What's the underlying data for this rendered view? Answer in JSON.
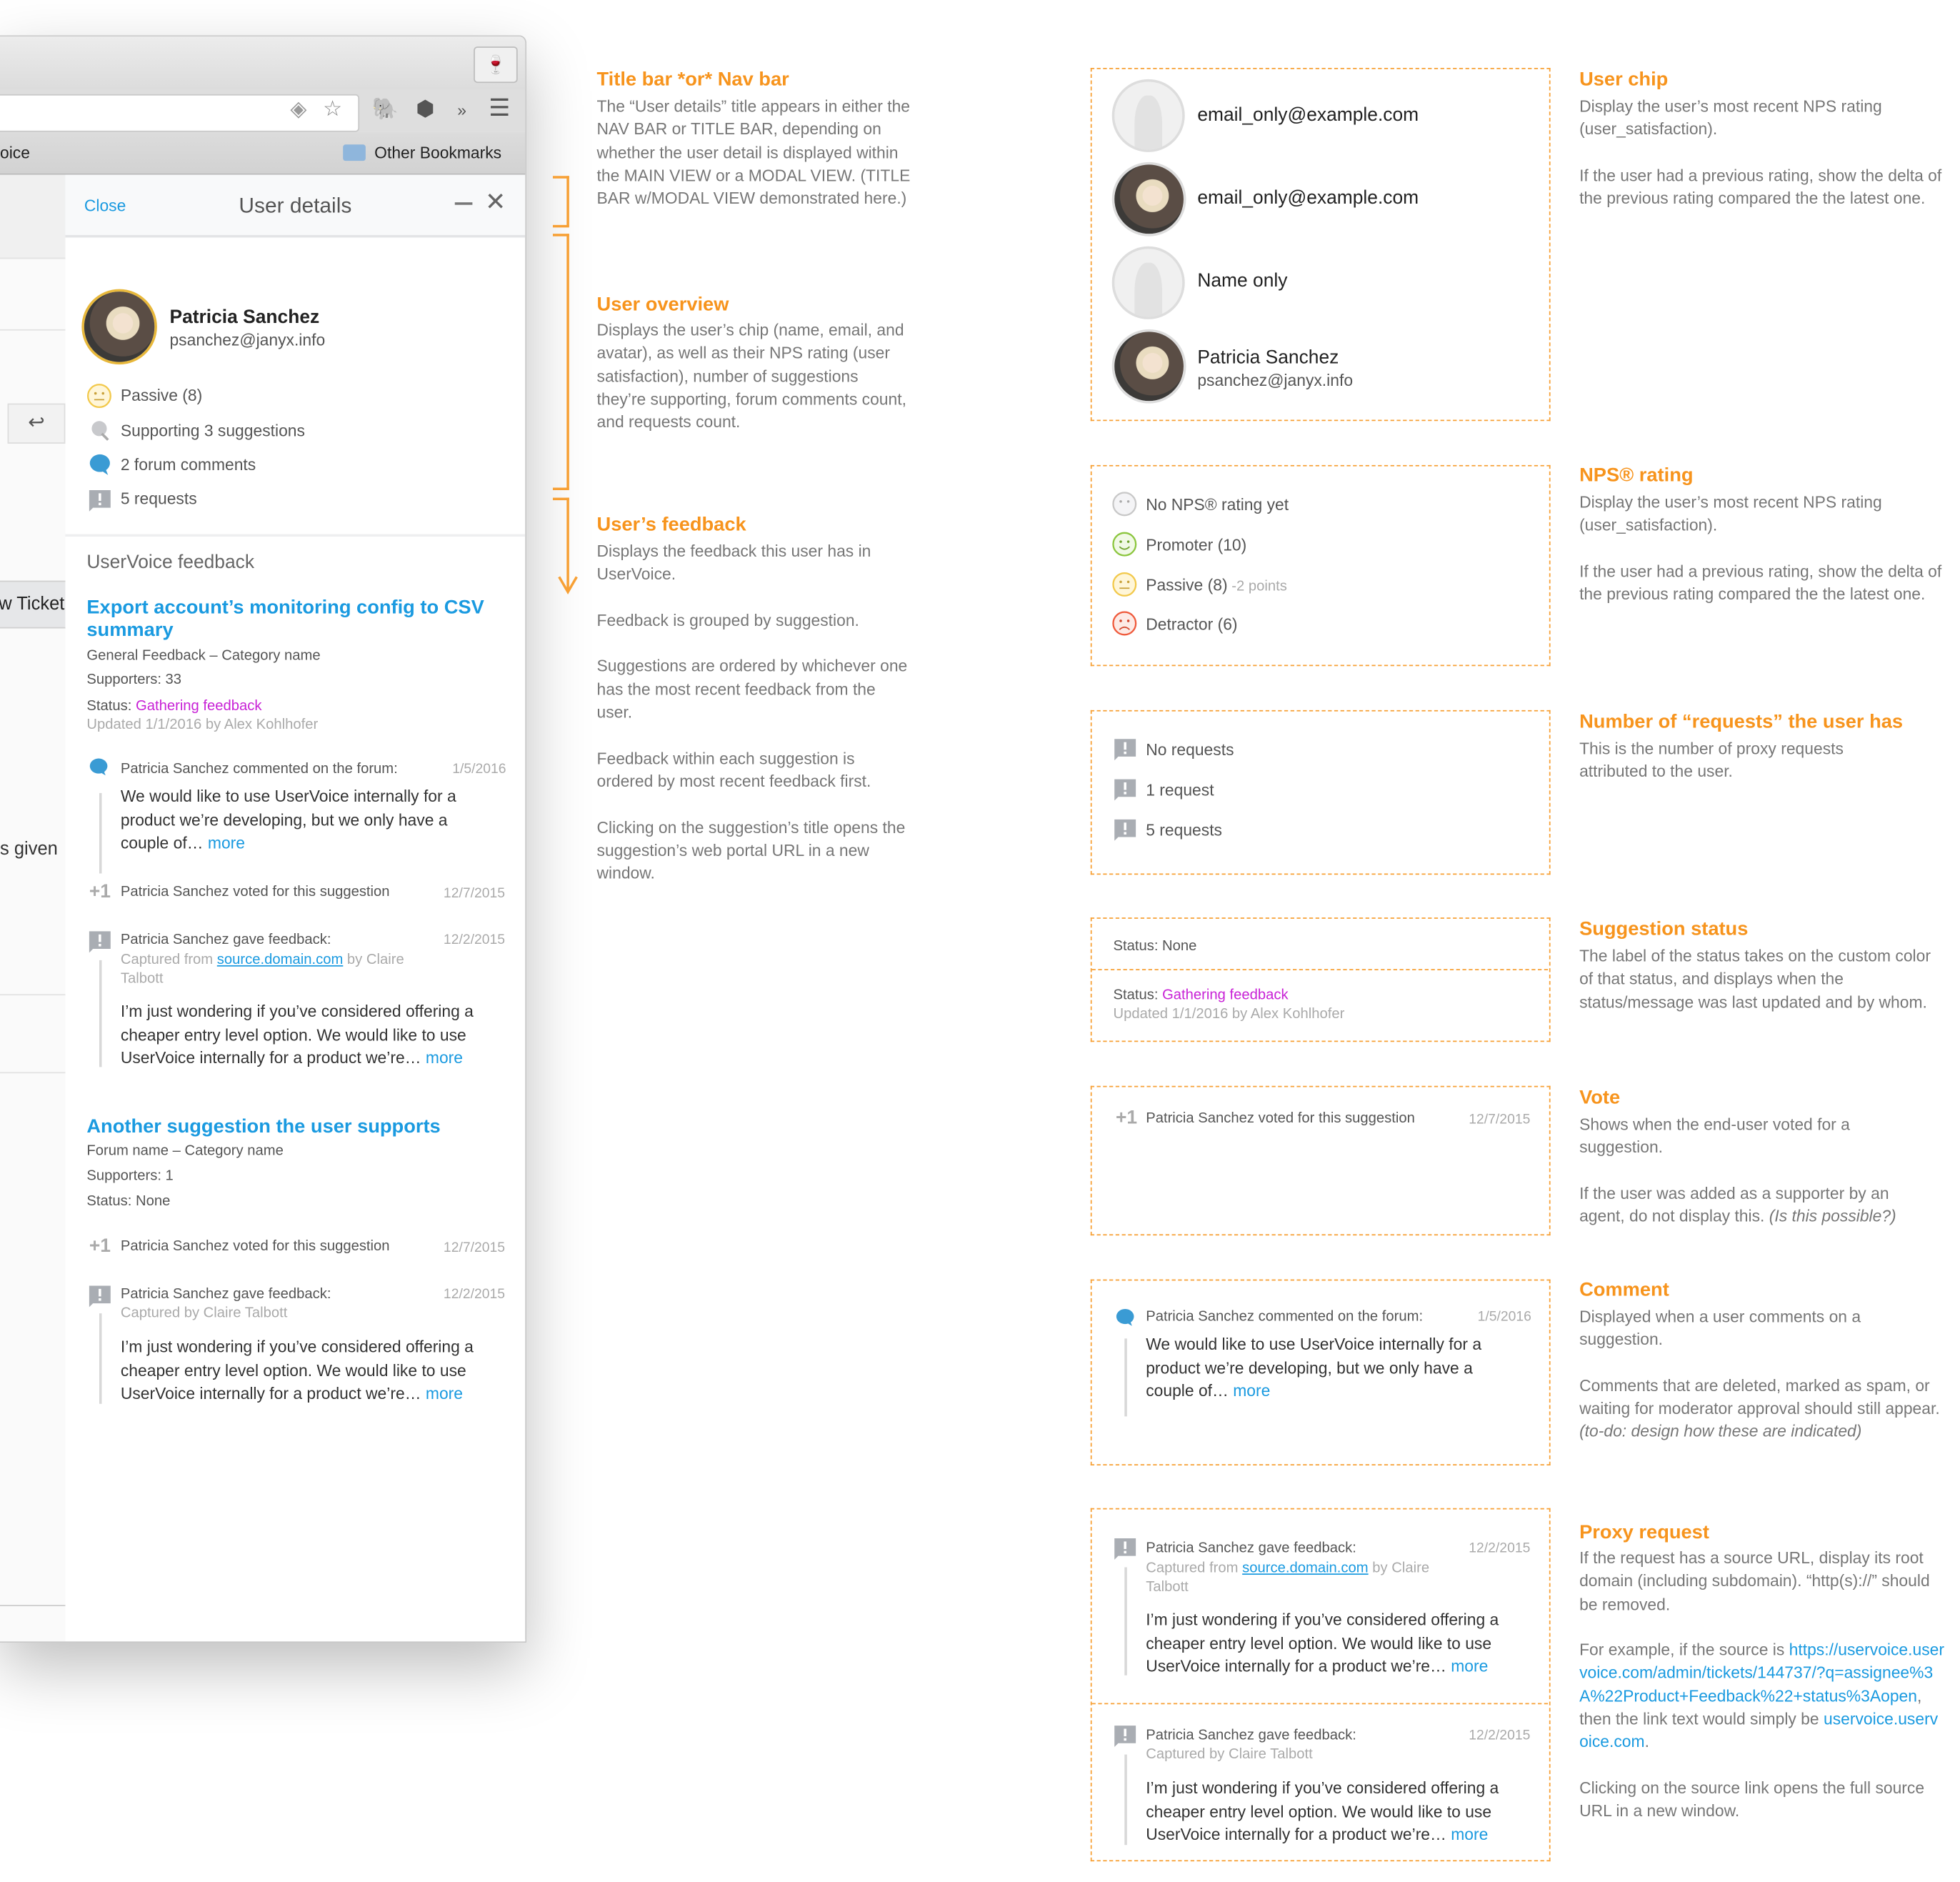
{
  "browser": {
    "bookmark_partial": "oice",
    "other_bookmarks": "Other Bookmarks",
    "icons": [
      "wine-glass-icon",
      "diamond-icon",
      "star-icon",
      "evernote-icon",
      "hexagon-extension-icon",
      "overflow-chevron-icon",
      "hamburger-menu-icon",
      "folder-icon"
    ]
  },
  "underlying_page": {
    "ticket_button_partial": "w Ticket",
    "given_partial": "s given"
  },
  "panel": {
    "close_label": "Close",
    "title": "User details",
    "user": {
      "name": "Patricia Sanchez",
      "email": "psanchez@janyx.info"
    },
    "stats": [
      {
        "icon": "passive-face-icon",
        "label": "Passive (8)"
      },
      {
        "icon": "lightbulb-icon",
        "label": "Supporting 3 suggestions"
      },
      {
        "icon": "comment-bubble-icon",
        "label": "2 forum comments"
      },
      {
        "icon": "request-exclamation-icon",
        "label": "5 requests"
      }
    ],
    "section_title": "UserVoice feedback",
    "suggestions": [
      {
        "title": "Export account’s monitoring config to CSV summary",
        "forum_category": "General Feedback – Category name",
        "supporters": "Supporters: 33",
        "status_label": "Status: ",
        "status_value": "Gathering feedback",
        "updated": "Updated 1/1/2016 by Alex Kohlhofer",
        "activity": [
          {
            "type": "comment",
            "header": "Patricia Sanchez commented on the forum:",
            "date": "1/5/2016",
            "body": "We would like to use UserVoice internally for a product we’re developing, but we only have a couple of… ",
            "more": "more"
          },
          {
            "type": "vote",
            "header": "Patricia Sanchez voted for this suggestion",
            "date": "12/7/2015",
            "plus": "+1"
          },
          {
            "type": "feedback",
            "header": "Patricia Sanchez gave feedback:",
            "date": "12/2/2015",
            "captured_prefix": "Captured from ",
            "source": "source.domain.com",
            "captured_suffix": " by Claire Talbott",
            "body": "I’m just wondering if you’ve considered offering a cheaper entry level option. We would like to use UserVoice internally for a product we’re… ",
            "more": "more"
          }
        ]
      },
      {
        "title": "Another suggestion the user supports",
        "forum_category": "Forum name – Category name",
        "supporters": "Supporters: 1",
        "status_label": "Status: None",
        "activity": [
          {
            "type": "vote",
            "header": "Patricia Sanchez voted for this suggestion",
            "date": "12/7/2015",
            "plus": "+1"
          },
          {
            "type": "feedback",
            "header": "Patricia Sanchez gave feedback:",
            "date": "12/2/2015",
            "captured": "Captured by Claire Talbott",
            "body": "I’m just wondering if you’ve considered offering a cheaper entry level option. We would like to use UserVoice internally for a product we’re… ",
            "more": "more"
          }
        ]
      }
    ]
  },
  "annotations_middle": [
    {
      "title": "Title bar *or* Nav bar",
      "text": "The “User details” title appears in either the NAV BAR or TITLE BAR, depending on whether the user detail is displayed within the MAIN VIEW or a MODAL VIEW. (TITLE BAR w/MODAL VIEW demonstrated here.)"
    },
    {
      "title": "User overview",
      "text": "Displays the user’s chip (name, email, and avatar), as well as their NPS rating (user satisfaction), number of suggestions they’re supporting, forum comments count, and requests count."
    },
    {
      "title": "User’s feedback",
      "paragraphs": [
        "Displays the feedback this user has in UserVoice.",
        "Feedback is grouped by suggestion.",
        "Suggestions are ordered by whichever one has the most recent feedback from the user.",
        "Feedback within each suggestion is ordered by most recent feedback first.",
        "Clicking on the suggestion’s title opens the suggestion’s web portal URL in a new window."
      ]
    }
  ],
  "examples": {
    "user_chips": [
      {
        "avatar": "placeholder",
        "primary": "email_only@example.com"
      },
      {
        "avatar": "photo",
        "primary": "email_only@example.com"
      },
      {
        "avatar": "placeholder",
        "primary": "Name only"
      },
      {
        "avatar": "photo",
        "primary": "Patricia Sanchez",
        "secondary": "psanchez@janyx.info"
      }
    ],
    "nps": [
      {
        "icon": "no-rating-face-icon",
        "color": "#c8c8c8",
        "label": "No NPS® rating yet"
      },
      {
        "icon": "promoter-face-icon",
        "color": "#8cc63f",
        "label": "Promoter (10)"
      },
      {
        "icon": "passive-face-icon",
        "color": "#f2c94c",
        "label": "Passive (8)",
        "delta": " -2 points"
      },
      {
        "icon": "detractor-face-icon",
        "color": "#ef5a3c",
        "label": "Detractor (6)"
      }
    ],
    "requests": [
      "No requests",
      "1 request",
      "5 requests"
    ],
    "status": {
      "none": "Status: None",
      "label": "Status: ",
      "value": "Gathering feedback",
      "updated": "Updated 1/1/2016 by Alex Kohlhofer"
    }
  },
  "annotations_right": {
    "user_chip": {
      "title": "User chip",
      "p1": "Display the user’s most recent NPS rating (user_satisfaction).",
      "p2": "If the user had a previous rating, show the delta of the previous rating compared the the latest one."
    },
    "nps": {
      "title": "NPS® rating",
      "p1": "Display the user’s most recent NPS rating (user_satisfaction).",
      "p2": "If the user had a previous rating, show the delta of the previous rating compared the the latest one."
    },
    "requests": {
      "title": "Number of “requests” the user has",
      "p1": "This is the number of proxy requests attributed to the user."
    },
    "status": {
      "title": "Suggestion status",
      "p1": "The label of the status takes on the custom color of that status, and displays when the status/message was last updated and by whom."
    },
    "vote": {
      "title": "Vote",
      "p1": "Shows when the end-user voted for a suggestion.",
      "p2": "If the user was added as a supporter by an agent, do not display this. ",
      "p2_italic": "(Is this possible?)"
    },
    "comment": {
      "title": "Comment",
      "p1": "Displayed when a user comments on a suggestion.",
      "p2": "Comments that are deleted, marked as spam, or waiting for moderator approval should still appear. ",
      "p2_italic": "(to-do: design how these are indicated)"
    },
    "proxy": {
      "title": "Proxy request",
      "p1": "If the request has a source URL, display its root domain (including subdomain). “http(s)://” should be removed.",
      "p2_a": "For example, if the source is ",
      "p2_url": "https://uservoice.uservoice.com/admin/tickets/144737/?q=assignee%3A%22Product+Feedback%22+status%3Aopen",
      "p2_b": ", then the link text would simply be ",
      "p2_domain": "uservoice.uservoice.com",
      "p2_c": ".",
      "p3": "Clicking on the source link opens the full source URL in a new window."
    }
  },
  "colors": {
    "accent_orange": "#f7941d",
    "link_blue": "#1a9ae0",
    "status_purple": "#c822d6",
    "avatar_ring": "#e8b83b"
  }
}
